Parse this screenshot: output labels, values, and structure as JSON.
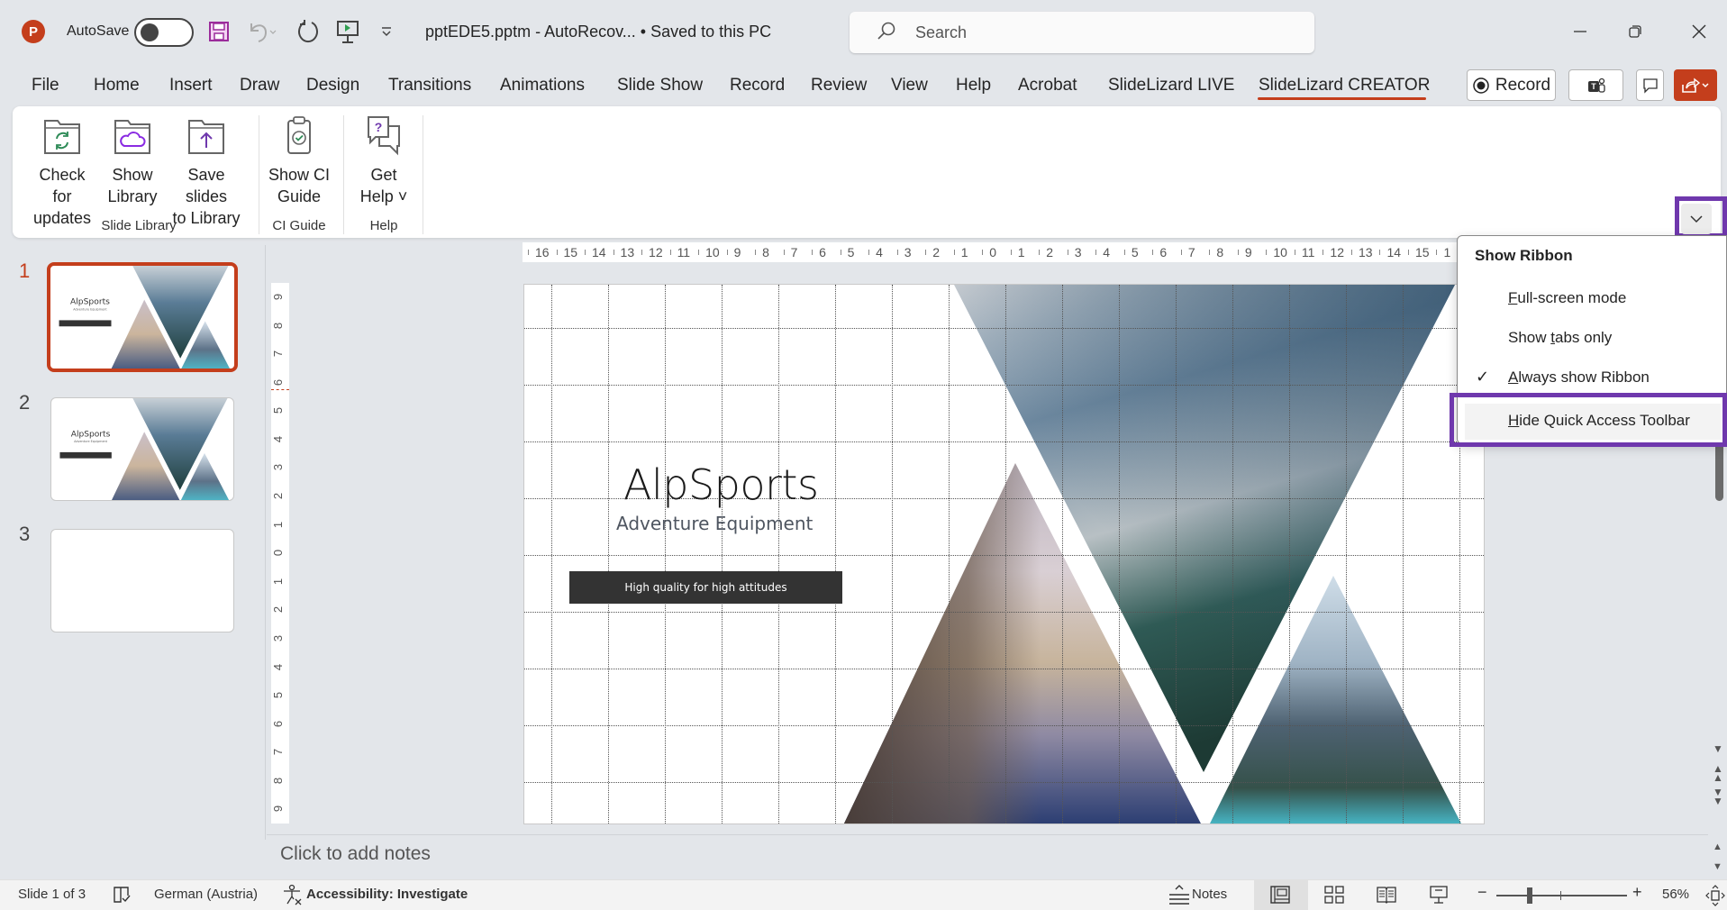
{
  "titlebar": {
    "app_icon": "powerpoint-logo-icon",
    "app_letter": "P",
    "autosave_label": "AutoSave",
    "autosave_state": "Off",
    "document_title": "pptEDE5.pptm  -  AutoRecov...  • Saved to this PC",
    "search_placeholder": "Search",
    "qat_icons": [
      "save-icon",
      "undo-icon",
      "redo-icon",
      "start-slideshow-icon",
      "customize-qat-icon"
    ],
    "window_controls": [
      "minimize-icon",
      "restore-icon",
      "close-icon"
    ]
  },
  "tabs": [
    {
      "label": "File"
    },
    {
      "label": "Home"
    },
    {
      "label": "Insert"
    },
    {
      "label": "Draw"
    },
    {
      "label": "Design"
    },
    {
      "label": "Transitions"
    },
    {
      "label": "Animations"
    },
    {
      "label": "Slide Show"
    },
    {
      "label": "Record"
    },
    {
      "label": "Review"
    },
    {
      "label": "View"
    },
    {
      "label": "Help"
    },
    {
      "label": "Acrobat"
    },
    {
      "label": "SlideLizard LIVE"
    },
    {
      "label": "SlideLizard CREATOR",
      "active": true
    }
  ],
  "tab_actions": {
    "record_label": "Record",
    "teams_icon": "teams-icon",
    "comments_icon": "comment-icon",
    "share_icon": "share-icon"
  },
  "ribbon": {
    "groups": [
      {
        "label": "Slide Library",
        "buttons": [
          {
            "line1": "Check for",
            "line2": "updates",
            "icon": "folder-refresh-icon"
          },
          {
            "line1": "Show",
            "line2": "Library",
            "icon": "folder-cloud-icon"
          },
          {
            "line1": "Save slides",
            "line2": "to Library",
            "icon": "folder-upload-icon"
          }
        ]
      },
      {
        "label": "CI Guide",
        "buttons": [
          {
            "line1": "Show CI",
            "line2": "Guide",
            "icon": "clipboard-check-icon"
          }
        ]
      },
      {
        "label": "Help",
        "buttons": [
          {
            "line1": "Get",
            "line2": "Help ˅",
            "icon": "help-chat-icon"
          }
        ]
      }
    ],
    "collapse_icon": "chevron-down-icon"
  },
  "ribbon_menu": {
    "title": "Show Ribbon",
    "items": [
      {
        "access": "F",
        "rest": "ull-screen mode",
        "checked": false
      },
      {
        "pre": "Show ",
        "access": "t",
        "rest": "abs only",
        "checked": false
      },
      {
        "access": "A",
        "rest": "lways show Ribbon",
        "checked": true
      },
      {
        "access": "H",
        "rest": "ide Quick Access Toolbar",
        "checked": false,
        "highlighted": true
      }
    ],
    "check_glyph": "✓"
  },
  "thumbnails": [
    {
      "number": "1",
      "active": true,
      "title": "AlpSports",
      "subtitle": "Adventure Equipment",
      "banner": "High quality for high attitudes"
    },
    {
      "number": "2",
      "active": false,
      "title": "AlpSports",
      "subtitle": "Adventure Equipment",
      "banner": "High quality for high attitudes"
    },
    {
      "number": "3",
      "active": false,
      "blank": true
    }
  ],
  "ruler": {
    "horizontal": [
      "16",
      "15",
      "14",
      "13",
      "12",
      "11",
      "10",
      "9",
      "8",
      "7",
      "6",
      "5",
      "4",
      "3",
      "2",
      "1",
      "0",
      "1",
      "2",
      "3",
      "4",
      "5",
      "6",
      "7",
      "8",
      "9",
      "10",
      "11",
      "12",
      "13",
      "14",
      "15",
      "1"
    ],
    "vertical": [
      "9",
      "8",
      "7",
      "6",
      "5",
      "4",
      "3",
      "2",
      "1",
      "0",
      "1",
      "2",
      "3",
      "4",
      "5",
      "6",
      "7",
      "8",
      "9"
    ]
  },
  "slide": {
    "title": "AlpSports",
    "subtitle": "Adventure Equipment",
    "banner": "High quality for high attitudes",
    "images": [
      "mountain-glacier-photo",
      "cliff-valley-photo",
      "mountain-lake-photo"
    ]
  },
  "notes": {
    "placeholder": "Click to add notes"
  },
  "statusbar": {
    "slide_counter": "Slide 1 of 3",
    "spellcheck_icon": "spellcheck-book-icon",
    "language": "German (Austria)",
    "accessibility": "Accessibility: Investigate",
    "notes_label": "Notes",
    "views": [
      "normal-view-icon",
      "slide-sorter-icon",
      "reading-view-icon",
      "slideshow-view-icon"
    ],
    "zoom_percent": "56%",
    "zoom_value": 56,
    "fit_icon": "fit-to-window-icon"
  },
  "colors": {
    "accent": "#c43e1c",
    "highlight_outline": "#6f38ad",
    "chrome_bg": "#e3e6ea"
  }
}
